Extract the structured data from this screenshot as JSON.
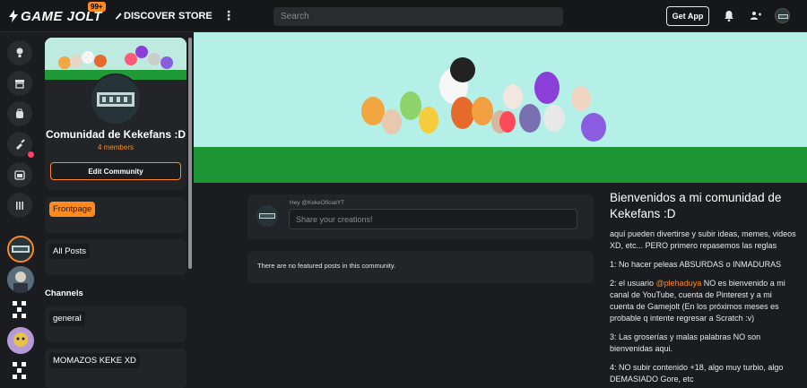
{
  "topbar": {
    "logo_text": "GAME JOLT",
    "notification_badge": "99+",
    "nav": {
      "discover": "DISCOVER",
      "store": "STORE",
      "more": "⋮"
    },
    "search_placeholder": "Search",
    "get_app": "Get App",
    "accent_color": "#ff8a1f"
  },
  "community": {
    "name": "Comunidad de Kekefans :D",
    "members": "4 members",
    "edit_button": "Edit Community",
    "channels_heading": "Channels",
    "nav_channels": [
      {
        "label": "Frontpage",
        "active": true
      },
      {
        "label": "All Posts",
        "active": false
      }
    ],
    "channels": [
      {
        "label": "general"
      },
      {
        "label": "MOMAZOS KEKE XD"
      }
    ]
  },
  "composer": {
    "greeting": "Hey @KekeOficialYT",
    "placeholder": "Share your creations!"
  },
  "featured": {
    "empty_text": "There are no featured posts in this community."
  },
  "about": {
    "title": "Bienvenidos a mi comunidad de Kekefans :D",
    "p1": "aquí pueden divertirse y subir ideas,  memes, videos XD, etc... PERO primero repasemos las reglas",
    "p2": "1: No hacer peleas ABSURDAS o INMADURAS",
    "p3_before": "2: el usuario ",
    "p3_mention": "@plehaduya",
    "p3_after": " NO es bienvenido a mi canal de YouTube, cuenta de Pinterest y a mi cuenta de Gamejolt (En los próximos meses es probable q intente regresar a Scratch :v)",
    "p4": "3: Las groserías y malas palabras NO son bienvenidas aqui.",
    "p5": "4: NO subir contenido +18, algo muy turbio, algo DEMASIADO Gore, etc"
  }
}
